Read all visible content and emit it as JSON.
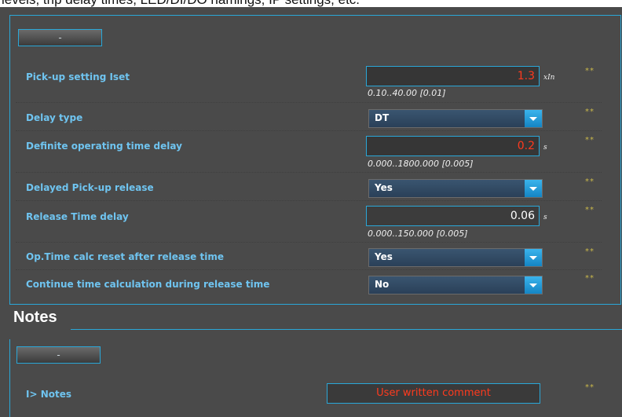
{
  "header": {
    "caption": "levels, trip delay times, LED/DI/DO namings, IP settings, etc."
  },
  "settings": {
    "collapse_label": "-",
    "rows": [
      {
        "label": "Pick-up setting Iset",
        "value": "1.3",
        "unit": "xIn",
        "range": "0.10..40.00 [0.01]",
        "marker": "**"
      },
      {
        "label": "Delay type",
        "value": "DT",
        "marker": "**"
      },
      {
        "label": "Definite operating time delay",
        "value": "0.2",
        "unit": "s",
        "range": "0.000..1800.000 [0.005]",
        "marker": "**"
      },
      {
        "label": "Delayed Pick-up release",
        "value": "Yes",
        "marker": "**"
      },
      {
        "label": "Release Time delay",
        "value": "0.06",
        "unit": "s",
        "range": "0.000..150.000 [0.005]",
        "marker": "**"
      },
      {
        "label": "Op.Time calc reset after release time",
        "value": "Yes",
        "marker": "**"
      },
      {
        "label": "Continue time calculation during release time",
        "value": "No",
        "marker": "**"
      }
    ]
  },
  "notes": {
    "heading": "Notes",
    "collapse_label": "-",
    "label": "I> Notes",
    "value": "User written comment",
    "marker": "**"
  },
  "colors": {
    "accent": "#2aa7d8",
    "label_text": "#6fc4f0",
    "edited_value": "#ff3a1e",
    "marker": "#c9b84a",
    "background": "#4a4a4a"
  }
}
